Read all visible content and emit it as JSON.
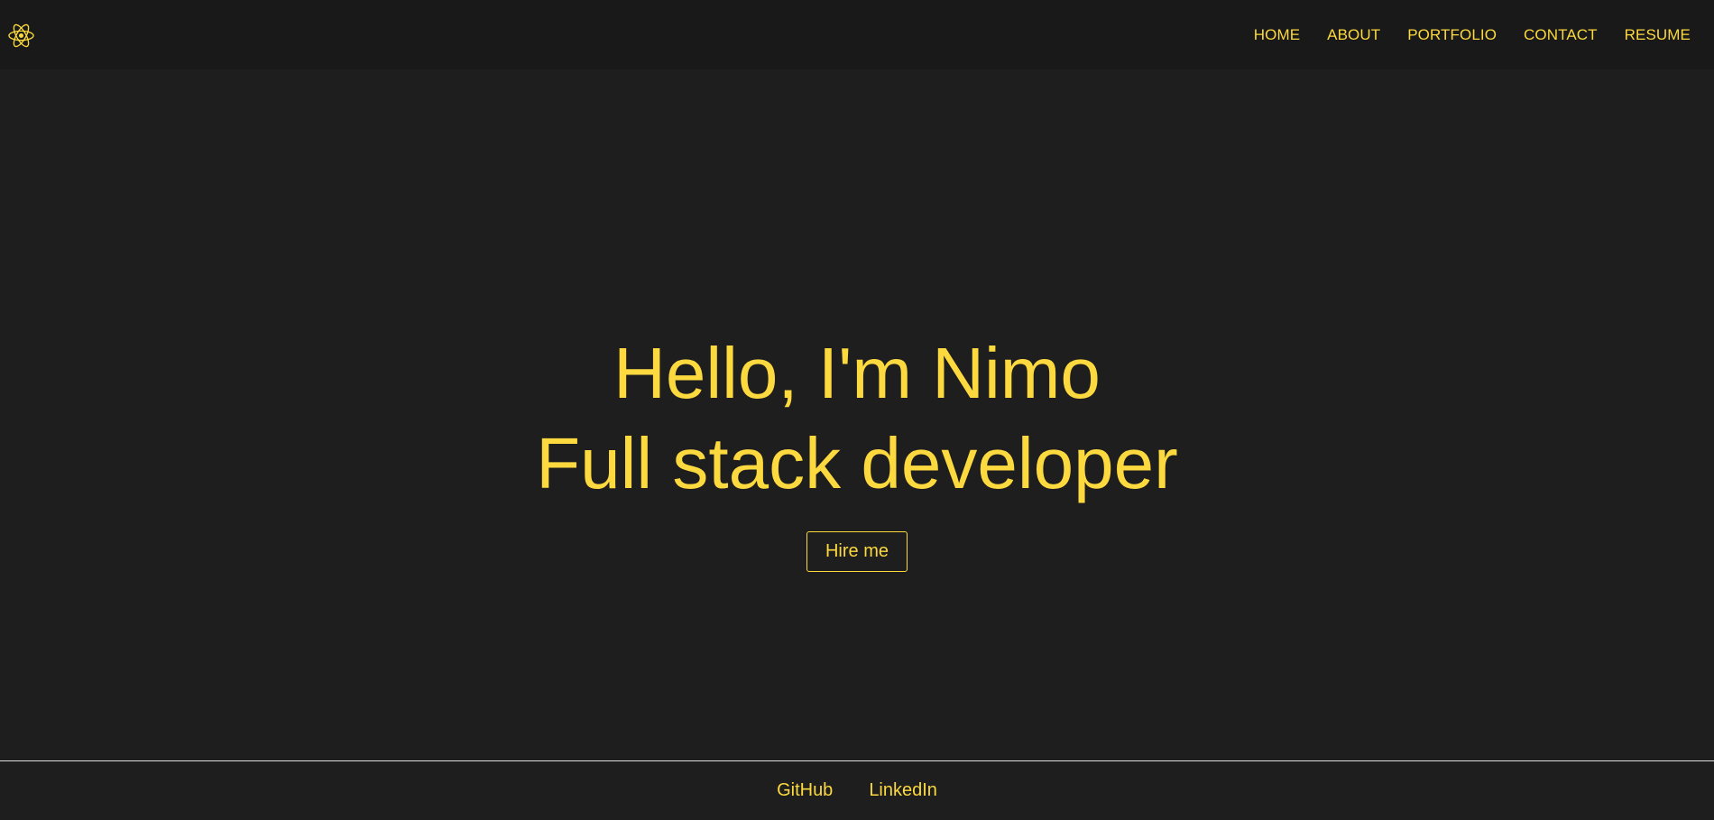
{
  "colors": {
    "accent": "#fcd93e",
    "background": "#1e1e1e",
    "navbar_background": "#191919",
    "footer_divider": "#e0e0e0"
  },
  "navbar": {
    "logo_icon": "react-atom-icon",
    "links": [
      {
        "label": "HOME"
      },
      {
        "label": "ABOUT"
      },
      {
        "label": "PORTFOLIO"
      },
      {
        "label": "CONTACT"
      },
      {
        "label": "RESUME"
      }
    ]
  },
  "hero": {
    "greeting": "Hello, I'm Nimo",
    "role": "Full stack developer",
    "cta_label": "Hire me"
  },
  "footer": {
    "links": [
      {
        "label": "GitHub"
      },
      {
        "label": "LinkedIn"
      }
    ]
  }
}
